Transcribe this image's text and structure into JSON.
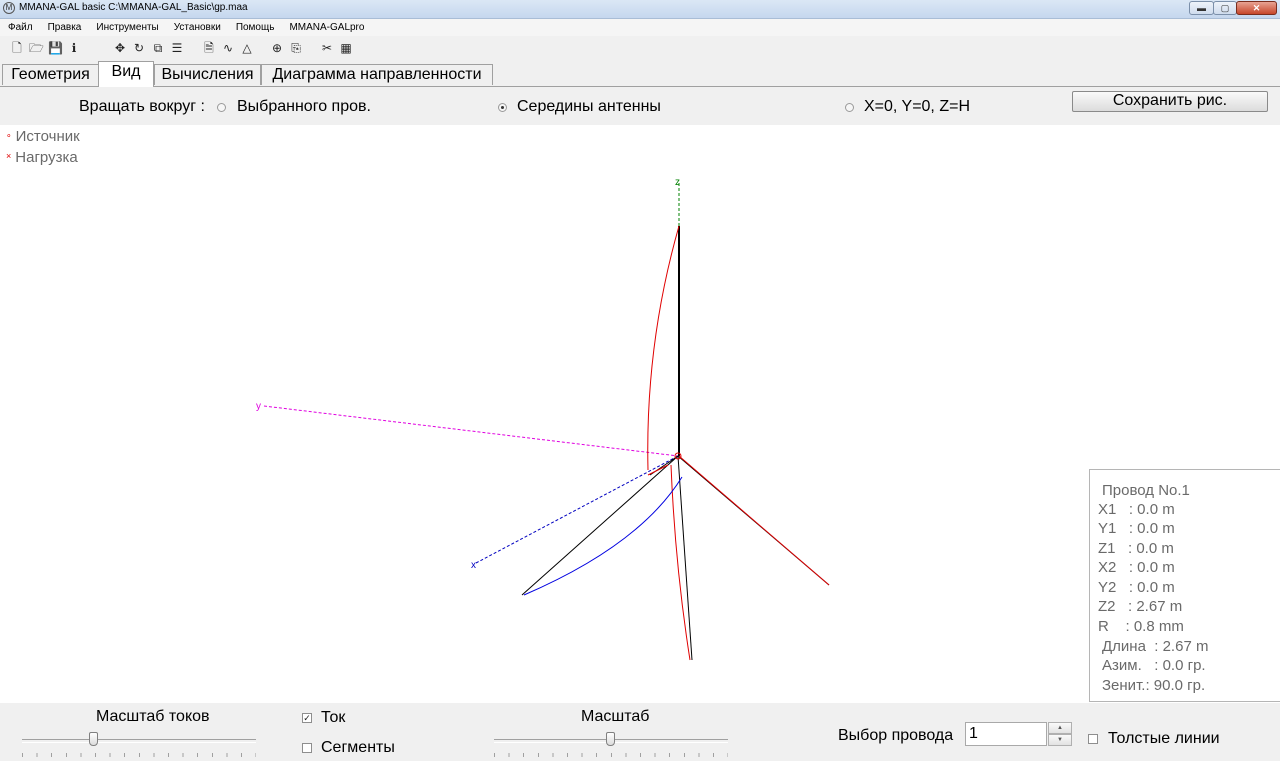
{
  "window": {
    "title": "MMANA-GAL basic C:\\MMANA-GAL_Basic\\gp.maa",
    "minimize_glyph": "▬",
    "maximize_glyph": "▢",
    "close_glyph": "✕"
  },
  "menu": {
    "items": [
      "Файл",
      "Правка",
      "Инструменты",
      "Установки",
      "Помощь",
      "MMANA-GALpro"
    ]
  },
  "toolbar": {
    "icons": [
      {
        "name": "new-file-icon",
        "glyph": "🗋"
      },
      {
        "name": "open-folder-icon",
        "glyph": "🗁"
      },
      {
        "name": "save-disk-icon",
        "glyph": "💾"
      },
      {
        "name": "info-icon",
        "glyph": "ℹ"
      },
      {
        "name": "move-icon",
        "glyph": "✥"
      },
      {
        "name": "rotate-icon",
        "glyph": "↻"
      },
      {
        "name": "copy-transform-icon",
        "glyph": "⧉"
      },
      {
        "name": "stack-icon",
        "glyph": "☰"
      },
      {
        "name": "document-icon",
        "glyph": "🗎"
      },
      {
        "name": "curve-icon",
        "glyph": "∿"
      },
      {
        "name": "triangle-icon",
        "glyph": "△"
      },
      {
        "name": "target-icon",
        "glyph": "⊕"
      },
      {
        "name": "clipboard-icon",
        "glyph": "⎘"
      },
      {
        "name": "tools-icon",
        "glyph": "✂"
      },
      {
        "name": "calculator-icon",
        "glyph": "▦"
      }
    ]
  },
  "tabs": [
    "Геометрия",
    "Вид",
    "Вычисления",
    "Диаграмма направленности"
  ],
  "rotate": {
    "label": "Вращать вокруг :",
    "option_selected_wire": "Выбранного пров.",
    "option_antenna_middle": "Середины антенны",
    "option_origin": "X=0, Y=0, Z=H",
    "selected": "Середины антенны"
  },
  "save_picture_button": "Сохранить рис.",
  "legend": {
    "source_mark": "∘",
    "source_label": "Источник",
    "load_mark": "×",
    "load_label": "Нагрузка"
  },
  "colors": {
    "wire": "#000000",
    "current_real": "#e00000",
    "current_imag": "#0000e0",
    "axis_y": "#e000e0",
    "axis_x": "#0000c0",
    "axis_z": "#008000"
  },
  "wire_info": {
    "title": "Провод No.1",
    "x1": "X1   : 0.0 m",
    "y1": "Y1   : 0.0 m",
    "z1": "Z1   : 0.0 m",
    "x2": "X2   : 0.0 m",
    "y2": "Y2   : 0.0 m",
    "z2": "Z2   : 2.67 m",
    "r": "R    : 0.8 mm",
    "length": "Длина  : 2.67 m",
    "azimuth": "Азим.   : 0.0 гр.",
    "zenith": "Зенит.: 90.0 гр."
  },
  "bottom": {
    "current_scale_label": "Масштаб токов",
    "current_checkbox": "Ток",
    "current_checked": true,
    "segments_checkbox": "Сегменты",
    "segments_checked": false,
    "scale_label": "Масштаб",
    "wire_select_label": "Выбор провода",
    "wire_select_value": "1",
    "thick_lines_checkbox": "Толстые линии",
    "thick_lines_checked": false
  }
}
